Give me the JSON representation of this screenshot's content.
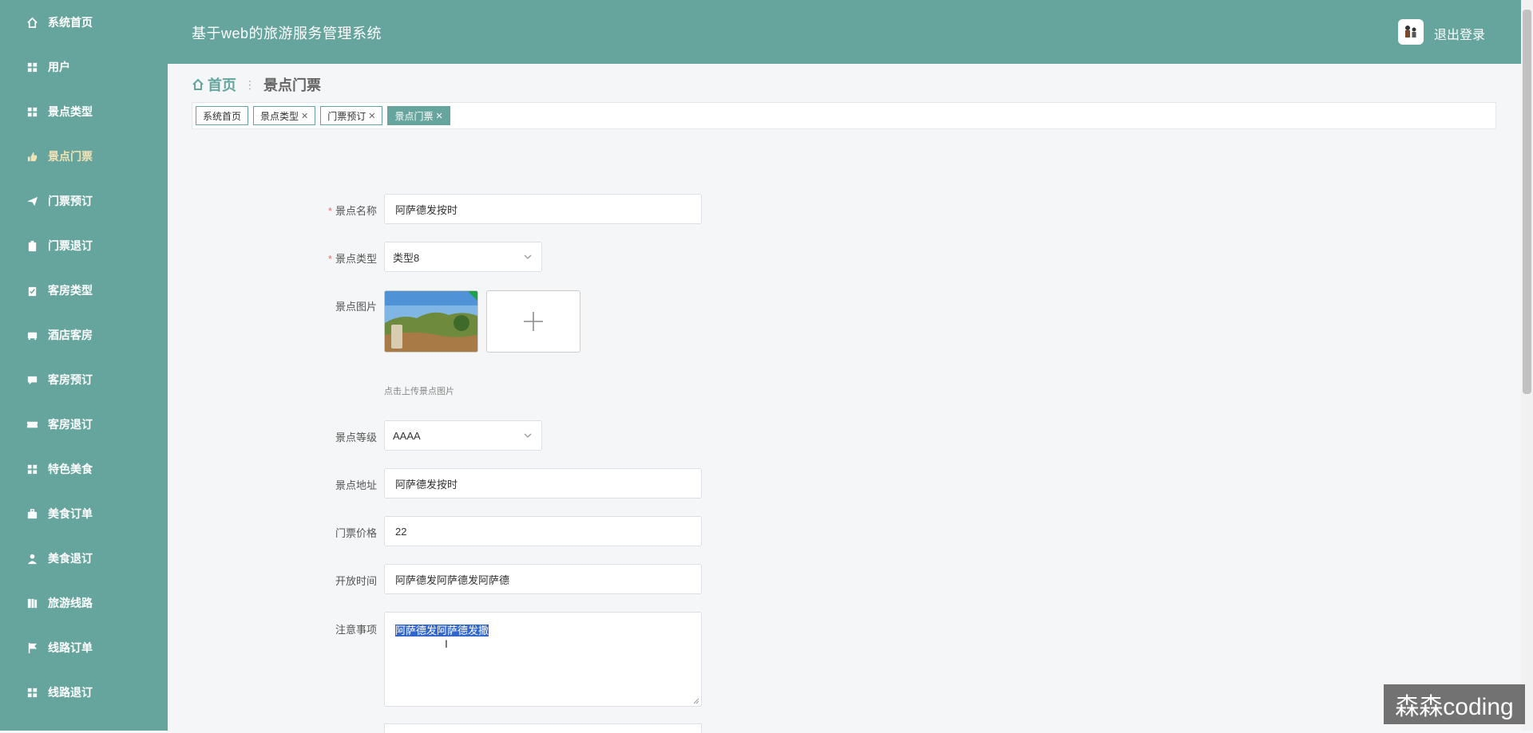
{
  "header": {
    "title": "基于web的旅游服务管理系统",
    "logout_label": "退出登录"
  },
  "sidebar": {
    "items": [
      {
        "label": "系统首页",
        "icon": "home-icon"
      },
      {
        "label": "用户",
        "icon": "grid-icon"
      },
      {
        "label": "景点类型",
        "icon": "grid-icon"
      },
      {
        "label": "景点门票",
        "icon": "thumb-icon",
        "active": true
      },
      {
        "label": "门票预订",
        "icon": "send-icon"
      },
      {
        "label": "门票退订",
        "icon": "clipboard-icon"
      },
      {
        "label": "客房类型",
        "icon": "clipboard-check-icon"
      },
      {
        "label": "酒店客房",
        "icon": "bed-icon"
      },
      {
        "label": "客房预订",
        "icon": "chat-icon"
      },
      {
        "label": "客房退订",
        "icon": "ticket-icon"
      },
      {
        "label": "特色美食",
        "icon": "grid-icon"
      },
      {
        "label": "美食订单",
        "icon": "briefcase-icon"
      },
      {
        "label": "美食退订",
        "icon": "user-icon"
      },
      {
        "label": "旅游线路",
        "icon": "book-icon"
      },
      {
        "label": "线路订单",
        "icon": "flag-icon"
      },
      {
        "label": "线路退订",
        "icon": "grid-icon"
      }
    ]
  },
  "breadcrumb": {
    "home": "首页",
    "separator": "ᐧ",
    "current": "景点门票"
  },
  "tags": [
    {
      "label": "系统首页",
      "closable": false
    },
    {
      "label": "景点类型",
      "closable": true
    },
    {
      "label": "门票预订",
      "closable": true
    },
    {
      "label": "景点门票",
      "closable": true,
      "active": true
    }
  ],
  "form": {
    "name_label": "景点名称",
    "name_value": "阿萨德发按时",
    "type_label": "景点类型",
    "type_value": "类型8",
    "image_label": "景点图片",
    "image_hint": "点击上传景点图片",
    "level_label": "景点等级",
    "level_value": "AAAA",
    "address_label": "景点地址",
    "address_value": "阿萨德发按时",
    "price_label": "门票价格",
    "price_value": "22",
    "hours_label": "开放时间",
    "hours_value": "阿萨德发阿萨德发阿萨德",
    "notes_label": "注意事项",
    "notes_value": "阿萨德发阿萨德发撒",
    "required_mark": "*"
  },
  "watermark": "森森coding",
  "colors": {
    "theme": "#66a59d",
    "active_menu": "#f1e3b5",
    "selection": "#3366cc"
  }
}
